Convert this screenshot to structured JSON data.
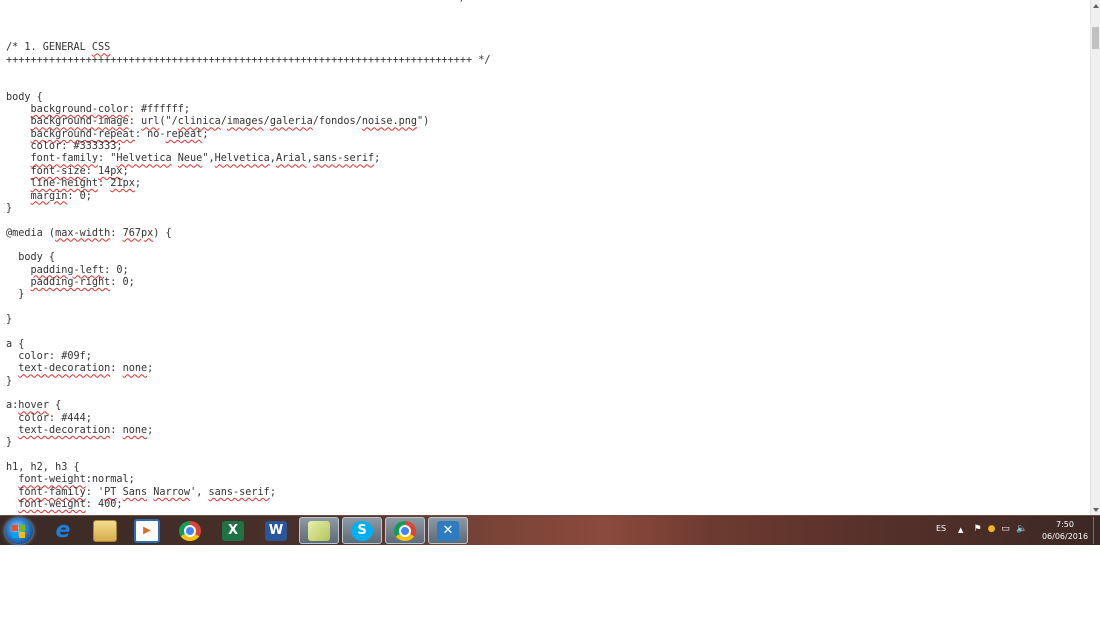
{
  "editor": {
    "code_lines": [
      "=======================================================================  */",
      "",
      "",
      "",
      "/* 1. GENERAL CSS",
      "++++++++++++++++++++++++++++++++++++++++++++++++++++++++++++++++++++++++++++ */",
      "",
      "",
      "body {",
      "    background-color: #ffffff;",
      "    background-image: url(\"/clinica/images/galeria/fondos/noise.png\")",
      "    background-repeat: no-repeat;",
      "    color: #333333;",
      "    font-family: \"Helvetica Neue\",Helvetica,Arial,sans-serif;",
      "    font-size: 14px;",
      "    line-height: 21px;",
      "    margin: 0;",
      "}",
      "",
      "@media (max-width: 767px) {",
      "",
      "  body {",
      "    padding-left: 0;",
      "    padding-right: 0;",
      "  }",
      "",
      "}",
      "",
      "a {",
      "  color: #09f;",
      "  text-decoration: none;",
      "}",
      "",
      "a:hover {",
      "  color: #444;",
      "  text-decoration: none;",
      "}",
      "",
      "h1, h2, h3 {",
      "  font-weight:normal;",
      "  font-family: 'PT Sans Narrow', sans-serif;",
      "  font-weight: 400;"
    ],
    "misspelled_words": [
      "CSS",
      "background-color",
      "background-image",
      "url",
      "clinica",
      "images",
      "galeria",
      "noise.png",
      "background-repeat",
      "repeat",
      "font-family",
      "Helvetica",
      "Neue",
      "Arial",
      "sans-serif",
      "font-size",
      "14px",
      "line-height",
      "21px",
      "margin",
      "max-width",
      "767px",
      "padding-left",
      "padding-right",
      "text-decoration",
      "none",
      "hover",
      "weight:normal",
      "PT",
      "Sans",
      "Narrow",
      "font-weight"
    ]
  },
  "taskbar": {
    "apps": [
      {
        "name": "start-button",
        "label": ""
      },
      {
        "name": "internet-explorer-icon",
        "label": "e",
        "color": "#1e7fd8"
      },
      {
        "name": "file-explorer-icon",
        "label": "",
        "color": "#e8c66a"
      },
      {
        "name": "media-player-icon",
        "label": "▶",
        "color": "#e06a1e"
      },
      {
        "name": "chrome-icon",
        "label": "",
        "color": "#dd4b39"
      },
      {
        "name": "excel-icon",
        "label": "X",
        "color": "#1f7244"
      },
      {
        "name": "word-icon",
        "label": "W",
        "color": "#2b579a"
      },
      {
        "name": "sticky-notes-icon",
        "label": "",
        "color": "#c9d98a"
      },
      {
        "name": "skype-icon",
        "label": "S",
        "color": "#00aff0"
      },
      {
        "name": "chrome-icon",
        "label": "",
        "color": "#dd4b39"
      },
      {
        "name": "tools-icon",
        "label": "✕",
        "color": "#2d7cc1"
      }
    ],
    "tray": {
      "language": "ES",
      "show_hidden": "▲",
      "time": "7:50",
      "date": "06/06/2016"
    }
  }
}
